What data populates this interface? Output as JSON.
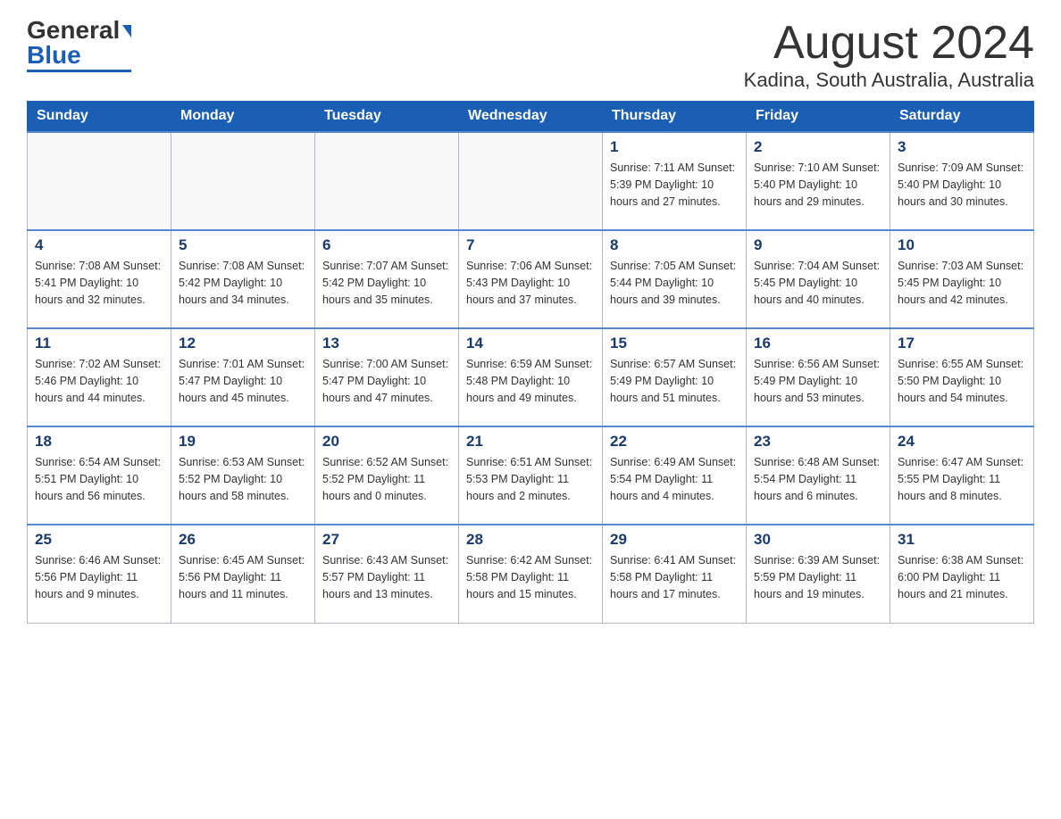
{
  "header": {
    "logo_general": "General",
    "logo_blue": "Blue",
    "month_title": "August 2024",
    "location": "Kadina, South Australia, Australia"
  },
  "days_of_week": [
    "Sunday",
    "Monday",
    "Tuesday",
    "Wednesday",
    "Thursday",
    "Friday",
    "Saturday"
  ],
  "weeks": [
    [
      {
        "day": "",
        "info": ""
      },
      {
        "day": "",
        "info": ""
      },
      {
        "day": "",
        "info": ""
      },
      {
        "day": "",
        "info": ""
      },
      {
        "day": "1",
        "info": "Sunrise: 7:11 AM\nSunset: 5:39 PM\nDaylight: 10 hours\nand 27 minutes."
      },
      {
        "day": "2",
        "info": "Sunrise: 7:10 AM\nSunset: 5:40 PM\nDaylight: 10 hours\nand 29 minutes."
      },
      {
        "day": "3",
        "info": "Sunrise: 7:09 AM\nSunset: 5:40 PM\nDaylight: 10 hours\nand 30 minutes."
      }
    ],
    [
      {
        "day": "4",
        "info": "Sunrise: 7:08 AM\nSunset: 5:41 PM\nDaylight: 10 hours\nand 32 minutes."
      },
      {
        "day": "5",
        "info": "Sunrise: 7:08 AM\nSunset: 5:42 PM\nDaylight: 10 hours\nand 34 minutes."
      },
      {
        "day": "6",
        "info": "Sunrise: 7:07 AM\nSunset: 5:42 PM\nDaylight: 10 hours\nand 35 minutes."
      },
      {
        "day": "7",
        "info": "Sunrise: 7:06 AM\nSunset: 5:43 PM\nDaylight: 10 hours\nand 37 minutes."
      },
      {
        "day": "8",
        "info": "Sunrise: 7:05 AM\nSunset: 5:44 PM\nDaylight: 10 hours\nand 39 minutes."
      },
      {
        "day": "9",
        "info": "Sunrise: 7:04 AM\nSunset: 5:45 PM\nDaylight: 10 hours\nand 40 minutes."
      },
      {
        "day": "10",
        "info": "Sunrise: 7:03 AM\nSunset: 5:45 PM\nDaylight: 10 hours\nand 42 minutes."
      }
    ],
    [
      {
        "day": "11",
        "info": "Sunrise: 7:02 AM\nSunset: 5:46 PM\nDaylight: 10 hours\nand 44 minutes."
      },
      {
        "day": "12",
        "info": "Sunrise: 7:01 AM\nSunset: 5:47 PM\nDaylight: 10 hours\nand 45 minutes."
      },
      {
        "day": "13",
        "info": "Sunrise: 7:00 AM\nSunset: 5:47 PM\nDaylight: 10 hours\nand 47 minutes."
      },
      {
        "day": "14",
        "info": "Sunrise: 6:59 AM\nSunset: 5:48 PM\nDaylight: 10 hours\nand 49 minutes."
      },
      {
        "day": "15",
        "info": "Sunrise: 6:57 AM\nSunset: 5:49 PM\nDaylight: 10 hours\nand 51 minutes."
      },
      {
        "day": "16",
        "info": "Sunrise: 6:56 AM\nSunset: 5:49 PM\nDaylight: 10 hours\nand 53 minutes."
      },
      {
        "day": "17",
        "info": "Sunrise: 6:55 AM\nSunset: 5:50 PM\nDaylight: 10 hours\nand 54 minutes."
      }
    ],
    [
      {
        "day": "18",
        "info": "Sunrise: 6:54 AM\nSunset: 5:51 PM\nDaylight: 10 hours\nand 56 minutes."
      },
      {
        "day": "19",
        "info": "Sunrise: 6:53 AM\nSunset: 5:52 PM\nDaylight: 10 hours\nand 58 minutes."
      },
      {
        "day": "20",
        "info": "Sunrise: 6:52 AM\nSunset: 5:52 PM\nDaylight: 11 hours\nand 0 minutes."
      },
      {
        "day": "21",
        "info": "Sunrise: 6:51 AM\nSunset: 5:53 PM\nDaylight: 11 hours\nand 2 minutes."
      },
      {
        "day": "22",
        "info": "Sunrise: 6:49 AM\nSunset: 5:54 PM\nDaylight: 11 hours\nand 4 minutes."
      },
      {
        "day": "23",
        "info": "Sunrise: 6:48 AM\nSunset: 5:54 PM\nDaylight: 11 hours\nand 6 minutes."
      },
      {
        "day": "24",
        "info": "Sunrise: 6:47 AM\nSunset: 5:55 PM\nDaylight: 11 hours\nand 8 minutes."
      }
    ],
    [
      {
        "day": "25",
        "info": "Sunrise: 6:46 AM\nSunset: 5:56 PM\nDaylight: 11 hours\nand 9 minutes."
      },
      {
        "day": "26",
        "info": "Sunrise: 6:45 AM\nSunset: 5:56 PM\nDaylight: 11 hours\nand 11 minutes."
      },
      {
        "day": "27",
        "info": "Sunrise: 6:43 AM\nSunset: 5:57 PM\nDaylight: 11 hours\nand 13 minutes."
      },
      {
        "day": "28",
        "info": "Sunrise: 6:42 AM\nSunset: 5:58 PM\nDaylight: 11 hours\nand 15 minutes."
      },
      {
        "day": "29",
        "info": "Sunrise: 6:41 AM\nSunset: 5:58 PM\nDaylight: 11 hours\nand 17 minutes."
      },
      {
        "day": "30",
        "info": "Sunrise: 6:39 AM\nSunset: 5:59 PM\nDaylight: 11 hours\nand 19 minutes."
      },
      {
        "day": "31",
        "info": "Sunrise: 6:38 AM\nSunset: 6:00 PM\nDaylight: 11 hours\nand 21 minutes."
      }
    ]
  ]
}
